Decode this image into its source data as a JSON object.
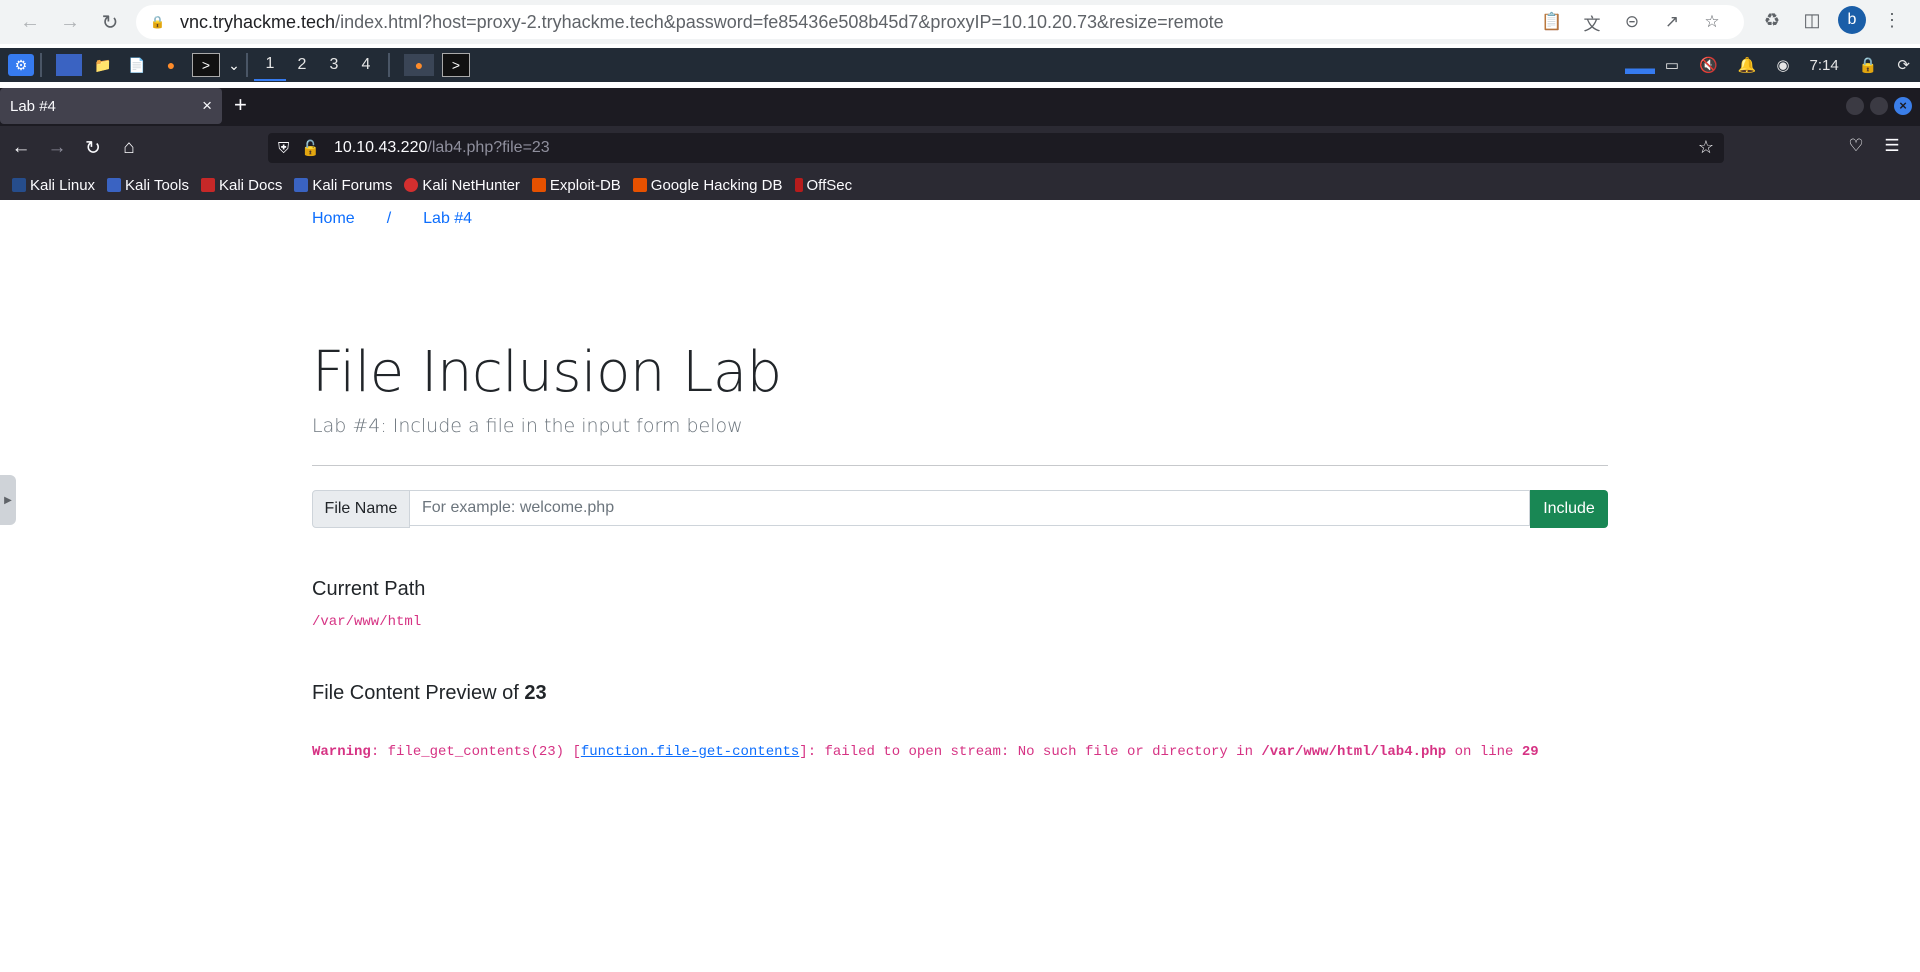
{
  "chrome": {
    "url_host": "vnc.tryhackme.tech",
    "url_rest": "/index.html?host=proxy-2.tryhackme.tech&password=fe85436e508b45d7&proxyIP=10.10.20.73&resize=remote",
    "profile_initial": "b"
  },
  "taskbar": {
    "workspaces": [
      "1",
      "2",
      "3",
      "4"
    ],
    "clock": "7:14"
  },
  "firefox": {
    "tab_title": "Lab #4",
    "url_host": "10.10.43.220",
    "url_path": "/lab4.php?file=23",
    "bookmarks": [
      "Kali Linux",
      "Kali Tools",
      "Kali Docs",
      "Kali Forums",
      "Kali NetHunter",
      "Exploit-DB",
      "Google Hacking DB",
      "OffSec"
    ]
  },
  "page": {
    "breadcrumb": {
      "home": "Home",
      "sep": "/",
      "current": "Lab #4"
    },
    "title": "File Inclusion Lab",
    "subtitle": "Lab #4: Include a file in the input form below",
    "form": {
      "label": "File Name",
      "placeholder": "For example: welcome.php",
      "button": "Include"
    },
    "current_path_heading": "Current Path",
    "current_path": "/var/www/html",
    "preview_heading": "File Content Preview of",
    "preview_file": "23",
    "warning": {
      "label": "Warning",
      "text1": ": file_get_contents(23) [",
      "link": "function.file-get-contents",
      "text2": "]: failed to open stream: No such file or directory in ",
      "file": "/var/www/html/lab4.php",
      "text3": " on line ",
      "line": "29"
    }
  },
  "colors": {
    "accent_link": "#0d6efd",
    "include_button": "#198754",
    "code_pink": "#d63384"
  }
}
